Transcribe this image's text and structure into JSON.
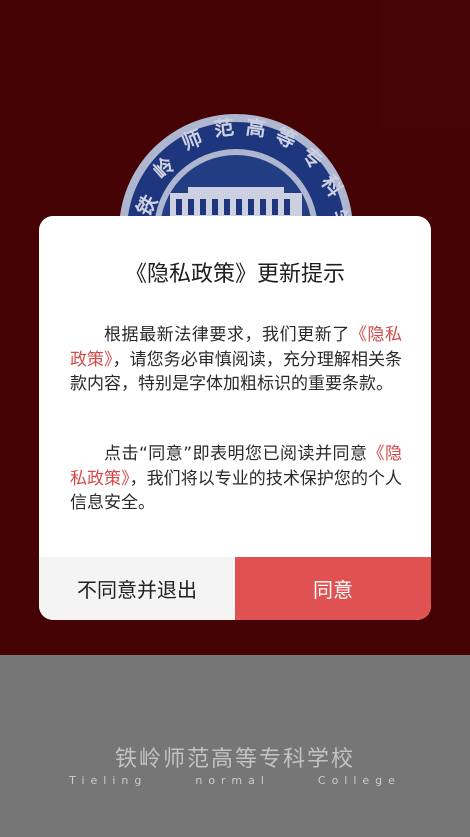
{
  "background": {
    "top_color": "#4a0407",
    "bottom_color": "#7e7e7e",
    "emblem": "school-seal-icon",
    "footer": {
      "title": "铁岭师范高等专科学校",
      "subtitle_words": [
        "Tieling",
        "normal",
        "College"
      ]
    }
  },
  "dialog": {
    "title": "《隐私政策》更新提示",
    "paragraph1": {
      "before": "根据最新法律要求，我们更新了",
      "link": "《隐私政策》",
      "after": "，请您务必审慎阅读，充分理解相关条款内容，特别是字体加粗标识的重要条款。"
    },
    "paragraph2": {
      "before": "点击“同意”即表明您已阅读并同意",
      "link": "《隐私政策》",
      "after": "，我们将以专业的技术保护您的个人信息安全。"
    },
    "buttons": {
      "disagree": "不同意并退出",
      "agree": "同意"
    },
    "colors": {
      "accent": "#e05252",
      "link": "#d44a4a"
    }
  }
}
